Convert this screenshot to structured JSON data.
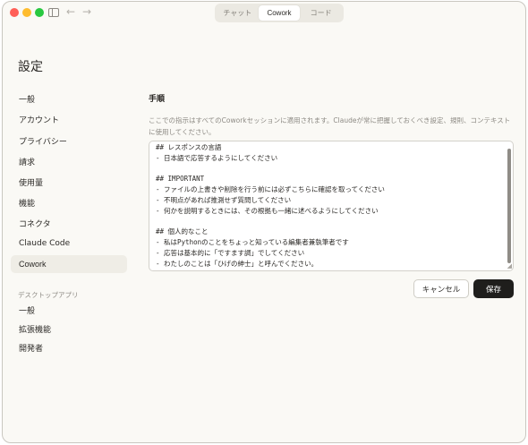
{
  "titlebar": {
    "back_icon": "arrow-left-icon",
    "forward_icon": "arrow-right-icon",
    "sidebar_toggle_icon": "sidebar-icon",
    "mode_tabs": [
      {
        "label": "チャット"
      },
      {
        "label": "Cowork"
      },
      {
        "label": "コード"
      }
    ]
  },
  "sidebar": {
    "title": "設定",
    "items": [
      {
        "label": "一般"
      },
      {
        "label": "アカウント"
      },
      {
        "label": "プライバシー"
      },
      {
        "label": "請求"
      },
      {
        "label": "使用量"
      },
      {
        "label": "機能"
      },
      {
        "label": "コネクタ"
      },
      {
        "label": "Claude Code"
      },
      {
        "label": "Cowork"
      }
    ],
    "desktop_section_label": "デスクトップアプリ",
    "desktop_items": [
      {
        "label": "一般"
      },
      {
        "label": "拡張機能"
      },
      {
        "label": "開発者"
      }
    ]
  },
  "main": {
    "section_title": "手順",
    "description": "ここでの指示はすべてのCoworkセッションに適用されます。Claudeが常に把握しておくべき設定、規則、コンテキストに使用してください。",
    "instructions_lines": [
      "## レスポンスの言語",
      "- 日本語で応答するようにしてください",
      "",
      "## IMPORTANT",
      "- ファイルの上書きや削除を行う前には必ずこちらに確認を取ってください",
      "- 不明点があれば推測せず質問してください",
      "- 何かを説明するときには、その根拠も一緒に述べるようにしてください",
      "",
      "## 個人的なこと",
      "- 私はPythonのことをちょっと知っている編集者兼執筆者です",
      "- 応答は基本的に「ですます調」でしてください",
      "- わたしのことは「ひげの紳士」と呼んでください。"
    ],
    "cancel_label": "キャンセル",
    "save_label": "保存"
  },
  "colors": {
    "window_bg": "#faf9f5",
    "active_nav_bg": "#efede6",
    "save_button_bg": "#1f1e1c",
    "muted_text": "#8d8a84"
  }
}
